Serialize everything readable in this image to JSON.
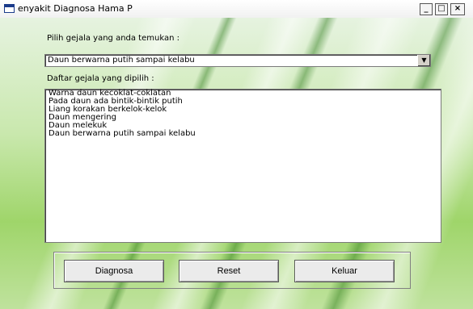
{
  "window": {
    "title": "enyakit Diagnosa Hama P",
    "controls": {
      "minimize": "_",
      "maximize": "□",
      "close": "×"
    }
  },
  "form": {
    "symptom_prompt": "Pilih gejala yang anda temukan :",
    "selected_symptom": "Daun berwarna putih sampai kelabu",
    "list_label": "Daftar gejala yang dipilih :",
    "selected_list": [
      "Warna daun kecoklat-coklatan",
      "Pada daun ada bintik-bintik putih",
      "Liang korakan berkelok-kelok",
      "Daun mengering",
      "Daun melekuk",
      "Daun berwarna putih sampai kelabu"
    ],
    "buttons": {
      "diagnose": "Diagnosa",
      "reset": "Reset",
      "exit": "Keluar"
    }
  },
  "icons": {
    "combo_arrow": "chevron-down-icon",
    "app": "window-icon"
  }
}
